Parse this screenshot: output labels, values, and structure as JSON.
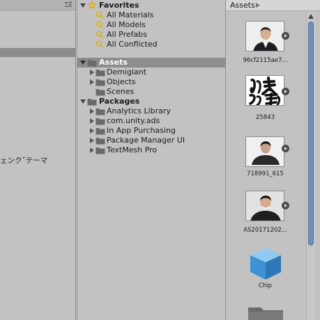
{
  "left_panel": {
    "partial_text": "ェンクˇテーマ"
  },
  "favorites": {
    "label": "Favorites",
    "items": [
      {
        "label": "All Materials"
      },
      {
        "label": "All Models"
      },
      {
        "label": "All Prefabs"
      },
      {
        "label": "All Conflicted"
      }
    ]
  },
  "assets": {
    "label": "Assets",
    "items": [
      {
        "label": "Demigiant"
      },
      {
        "label": "Objects"
      },
      {
        "label": "Scenes"
      }
    ]
  },
  "packages": {
    "label": "Packages",
    "items": [
      {
        "label": "Analytics Library"
      },
      {
        "label": "com.unity.ads"
      },
      {
        "label": "In App Purchasing"
      },
      {
        "label": "Package Manager UI"
      },
      {
        "label": "TextMesh Pro"
      }
    ]
  },
  "grid": {
    "breadcrumb": "Assets",
    "items": [
      {
        "label": "96cf2115ae7..."
      },
      {
        "label": "25843"
      },
      {
        "label": "718991_615"
      },
      {
        "label": "AS20171202..."
      },
      {
        "label": "Chip"
      }
    ]
  },
  "colors": {
    "panel_bg": "#c2c2c2",
    "selection": "#8d8d8d",
    "scroll_thumb": "#6f8fbb",
    "folder": "#6a6a6a",
    "star": "#f1c232",
    "search_icon": "#e0b000",
    "cube": "#3d93d6"
  },
  "icons": [
    "menu-icon",
    "star-icon",
    "search-icon",
    "folder-icon",
    "play-icon",
    "cube-icon",
    "scroll-up-icon"
  ]
}
